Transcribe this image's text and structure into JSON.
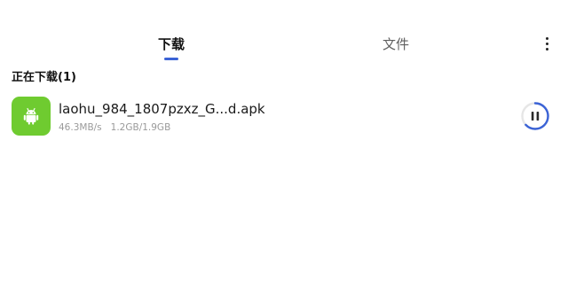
{
  "tabs": [
    {
      "label": "下载",
      "active": true
    },
    {
      "label": "文件",
      "active": false
    }
  ],
  "section": {
    "title": "正在下载(1)"
  },
  "downloads": [
    {
      "app_icon": "android-icon",
      "filename": "laohu_984_1807pzxz_G...d.apk",
      "speed": "46.3MB/s",
      "progress_text": "1.2GB/1.9GB",
      "progress_fraction": 0.63,
      "action_icon": "pause-icon"
    }
  ],
  "colors": {
    "accent": "#3b63d6",
    "app_icon_bg": "#6fcb30",
    "progress_track": "#e6e6e6"
  },
  "icons": {
    "more": "more-vertical-icon"
  }
}
